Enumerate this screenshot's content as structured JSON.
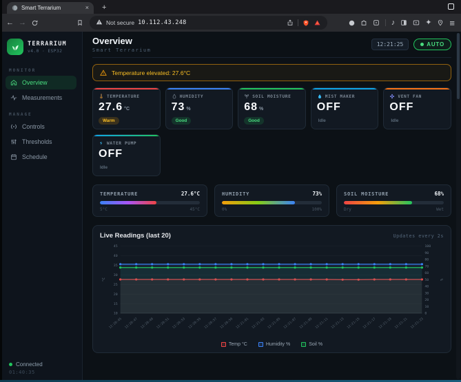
{
  "browser": {
    "tab_title": "Smart Terrarium",
    "security_label": "Not secure",
    "url": "10.112.43.248",
    "glyphs": {
      "close_tab": "×",
      "new_tab": "+",
      "back": "←",
      "forward": "→",
      "music": "♪",
      "sparkle": "✦",
      "menu": "≡"
    },
    "toolbar_icon_names": [
      "back-icon",
      "forward-icon",
      "reload-icon",
      "bookmark-icon",
      "warning-icon",
      "share-icon",
      "brave-shield-icon",
      "brave-rewards-icon",
      "profile-icon",
      "extensions-icon",
      "media-box-icon",
      "music-icon",
      "tab-square-icon",
      "cast-icon",
      "sparkle-icon",
      "location-pin-icon",
      "menu-icon"
    ]
  },
  "sidebar": {
    "logo_title": "TERRARIUM",
    "logo_subtitle": "v4.0 · ESP32",
    "sections": {
      "monitor_label": "MONITOR",
      "manage_label": "MANAGE"
    },
    "items": {
      "overview": "Overview",
      "measurements": "Measurements",
      "controls": "Controls",
      "thresholds": "Thresholds",
      "schedule": "Schedule"
    },
    "connection_status": "Connected",
    "uptime": "01:40:35"
  },
  "header": {
    "title": "Overview",
    "subtitle": "Smart Terrarium",
    "clock": "12:21:25",
    "mode_button": "AUTO"
  },
  "alert": {
    "message": "Temperature elevated: 27.6°C"
  },
  "cards": [
    {
      "label": "TEMPERATURE",
      "value": "27.6",
      "unit": "°C",
      "state": "Warm",
      "state_key": "warm",
      "accent": "#ef4444",
      "icon": "thermometer-icon"
    },
    {
      "label": "HUMIDITY",
      "value": "73",
      "unit": "%",
      "state": "Good",
      "state_key": "good",
      "accent": "#3b82f6",
      "icon": "droplet-icon"
    },
    {
      "label": "SOIL MOISTURE",
      "value": "68",
      "unit": "%",
      "state": "Good",
      "state_key": "good",
      "accent": "#22c55e",
      "icon": "plant-icon"
    },
    {
      "label": "MIST MAKER",
      "value": "OFF",
      "unit": "",
      "state": "Idle",
      "state_key": "idle",
      "accent": "#0ea5e9",
      "icon": "mist-droplet-icon"
    },
    {
      "label": "VENT FAN",
      "value": "OFF",
      "unit": "",
      "state": "Idle",
      "state_key": "idle",
      "accent": "#f97316",
      "icon": "fan-icon"
    },
    {
      "label": "WATER PUMP",
      "value": "OFF",
      "unit": "",
      "state": "Idle",
      "state_key": "idle",
      "accent": "linear-gradient(90deg,#0ea5e9,#22c55e)",
      "icon": "pump-icon"
    }
  ],
  "gauges": [
    {
      "label": "TEMPERATURE",
      "value": "27.6°C",
      "min": "5°C",
      "max": "45°C",
      "fill_pct": 56.5,
      "gradient": "linear-gradient(90deg,#3b82f6,#a855f7,#ef4444)"
    },
    {
      "label": "HUMIDITY",
      "value": "73%",
      "min": "0%",
      "max": "100%",
      "fill_pct": 73,
      "gradient": "linear-gradient(90deg,#f59e0b,#84cc16,#3b82f6)"
    },
    {
      "label": "SOIL MOISTURE",
      "value": "68%",
      "min": "Dry",
      "max": "Wet",
      "fill_pct": 68,
      "gradient": "linear-gradient(90deg,#ef4444,#f59e0b,#22c55e)"
    }
  ],
  "chart_data": {
    "type": "line",
    "title": "Live Readings (last 20)",
    "note": "Updates every 2s",
    "grid": true,
    "legend_position": "bottom",
    "x": [
      "12:20:45",
      "12:20:47",
      "12:20:49",
      "12:20:51",
      "12:20:53",
      "12:20:55",
      "12:20:57",
      "12:20:59",
      "12:21:01",
      "12:21:03",
      "12:21:05",
      "12:21:07",
      "12:21:09",
      "12:21:11",
      "12:21:13",
      "12:21:15",
      "12:21:17",
      "12:21:19",
      "12:21:21",
      "12:21:23"
    ],
    "left_axis": {
      "label": "°C",
      "min": 10,
      "max": 45,
      "ticks": [
        10,
        15,
        20,
        25,
        30,
        35,
        40,
        45
      ]
    },
    "right_axis": {
      "label": "%",
      "min": 0,
      "max": 100,
      "ticks": [
        0,
        10,
        20,
        30,
        40,
        50,
        60,
        70,
        80,
        90,
        100
      ]
    },
    "series": [
      {
        "name": "Temp °C",
        "color": "#ef4444",
        "axis": "left",
        "values": [
          27.6,
          27.6,
          27.6,
          27.6,
          27.6,
          27.6,
          27.6,
          27.6,
          27.6,
          27.6,
          27.6,
          27.6,
          27.6,
          27.6,
          27.5,
          27.5,
          27.6,
          27.6,
          27.6,
          27.6
        ]
      },
      {
        "name": "Humidity %",
        "color": "#3b82f6",
        "axis": "right",
        "values": [
          73,
          73,
          73,
          73,
          73,
          73,
          73,
          73,
          73,
          73,
          73,
          73,
          73,
          73,
          73,
          73,
          73,
          73,
          73,
          73
        ]
      },
      {
        "name": "Soil %",
        "color": "#22c55e",
        "axis": "right",
        "values": [
          68,
          68,
          68,
          68,
          68,
          68,
          68,
          68,
          68,
          68,
          68,
          68,
          68,
          68,
          68,
          68,
          68,
          68,
          68,
          68
        ]
      }
    ]
  }
}
